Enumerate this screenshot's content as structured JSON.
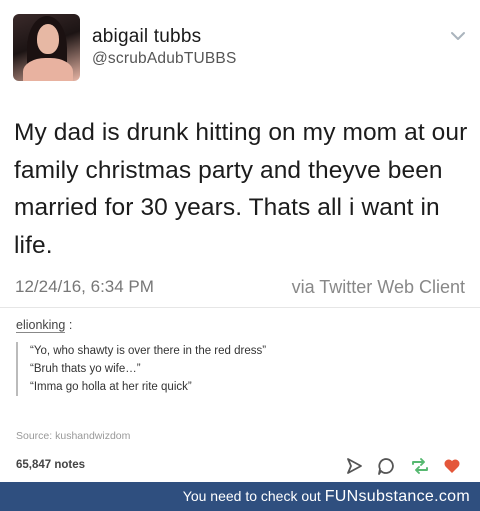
{
  "tweet": {
    "display_name": "abigail tubbs",
    "handle": "@scrubAdubTUBBS",
    "text": "My dad is drunk hitting on my mom at our family christmas party and theyve been married for 30 years. Thats all i want in life.",
    "timestamp": "12/24/16, 6:34 PM",
    "via": "via Twitter Web Client"
  },
  "reblog": {
    "username": "elionking",
    "username_suffix": ":",
    "quote_lines": [
      "“Yo, who shawty is over there in the red dress”",
      "“Bruh thats yo wife…”",
      "“Imma go holla at her rite quick”"
    ],
    "source": "Source: kushandwizdom",
    "notes": "65,847 notes"
  },
  "banner": {
    "text": "You need to check out",
    "brand": "FUNsubstance.com"
  },
  "icons": {
    "share": "share-icon",
    "reply": "reply-icon",
    "reblog": "reblog-icon",
    "like": "heart-icon",
    "menu": "chevron-down-icon"
  },
  "colors": {
    "reblog_green": "#56b870",
    "like_red": "#e4573a",
    "banner_blue": "#2f4f7f"
  }
}
